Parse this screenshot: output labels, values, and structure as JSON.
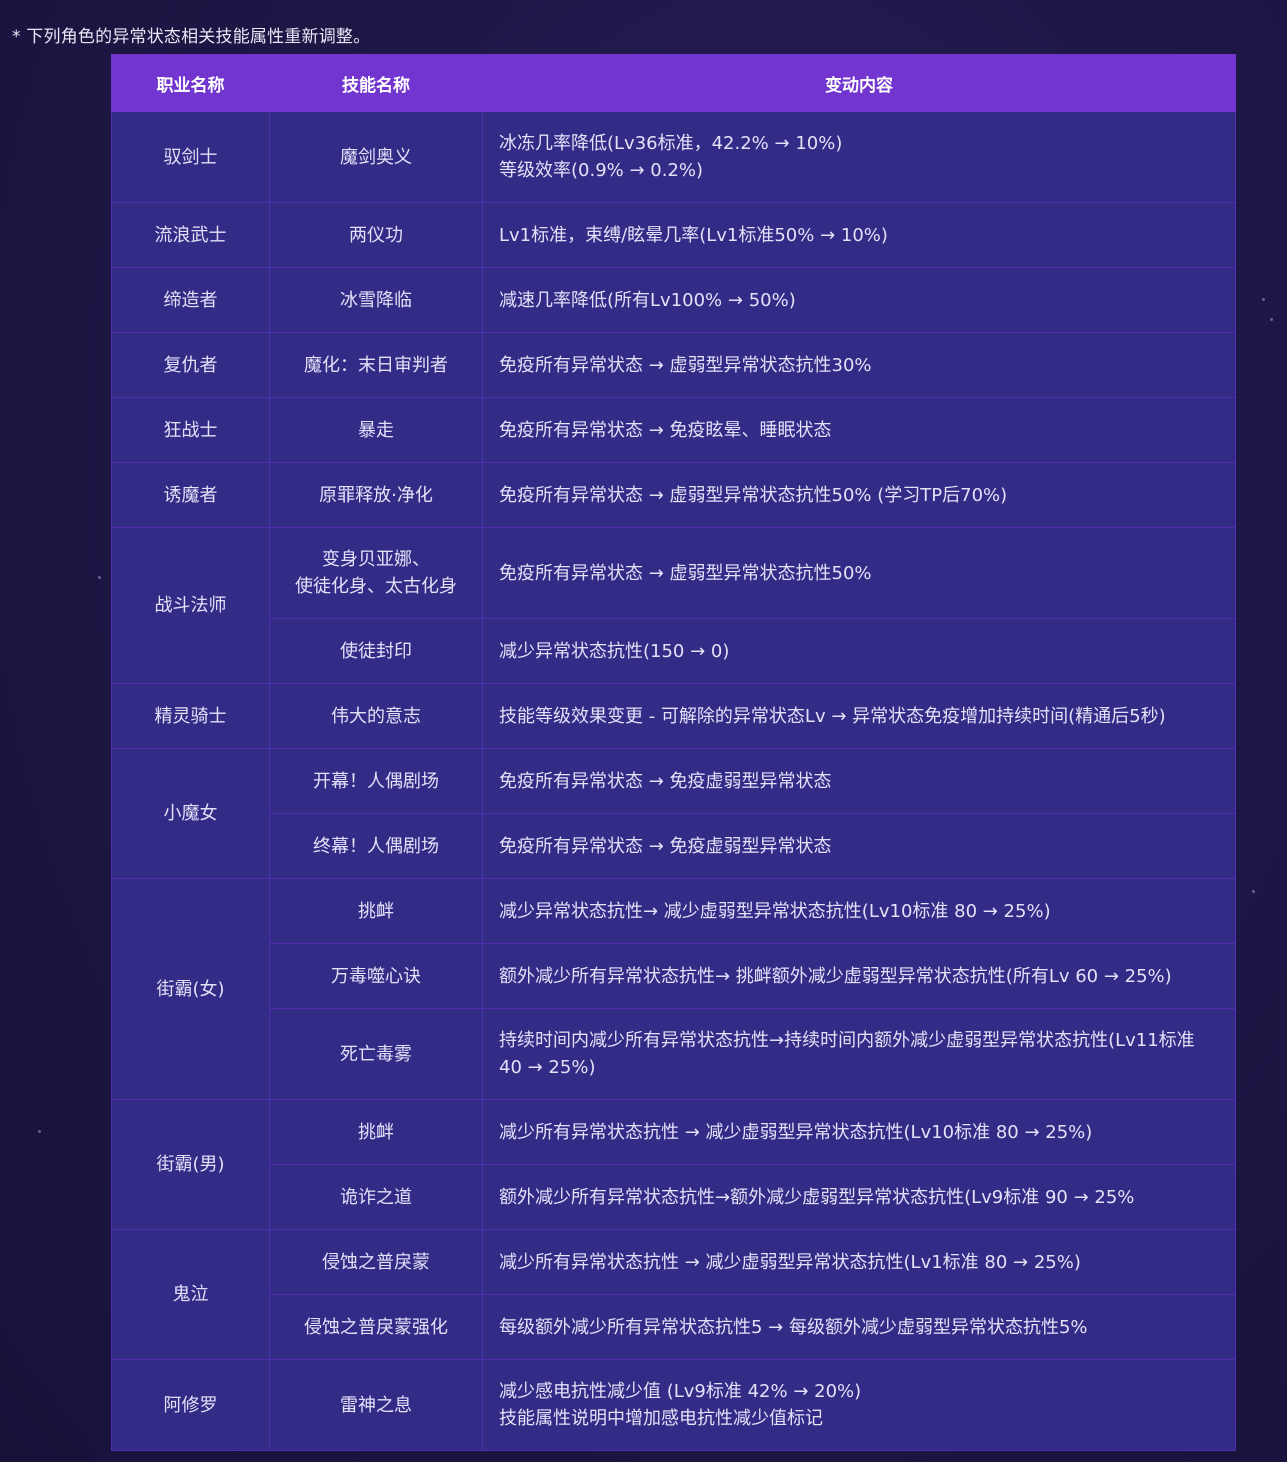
{
  "note": "* 下列角色的异常状态相关技能属性重新调整。",
  "columns": [
    "职业名称",
    "技能名称",
    "变动内容"
  ],
  "rows": [
    {
      "job": "驭剑士",
      "skill": "魔剑奥义",
      "lines": [
        "冰冻几率降低(Lv36标准，42.2% → 10%)",
        "等级效率(0.9% → 0.2%)"
      ]
    },
    {
      "job": "流浪武士",
      "skill": "两仪功",
      "lines": [
        "Lv1标准，束缚/眩晕几率(Lv1标准50% → 10%)"
      ]
    },
    {
      "job": "缔造者",
      "skill": "冰雪降临",
      "lines": [
        "减速几率降低(所有Lv100% → 50%)"
      ]
    },
    {
      "job": "复仇者",
      "skill": "魔化：末日审判者",
      "lines": [
        "免疫所有异常状态 → 虚弱型异常状态抗性30%"
      ]
    },
    {
      "job": "狂战士",
      "skill": "暴走",
      "lines": [
        "免疫所有异常状态 → 免疫眩晕、睡眠状态"
      ]
    },
    {
      "job": "诱魔者",
      "skill": "原罪释放·净化",
      "lines": [
        "免疫所有异常状态 → 虚弱型异常状态抗性50% (学习TP后70%)"
      ]
    },
    {
      "job": "战斗法师",
      "skill_lines": [
        "变身贝亚娜、",
        "使徒化身、太古化身"
      ],
      "lines": [
        "免疫所有异常状态 → 虚弱型异常状态抗性50%"
      ]
    },
    {
      "skill": "使徒封印",
      "lines": [
        "减少异常状态抗性(150 → 0)"
      ]
    },
    {
      "job": "精灵骑士",
      "skill": "伟大的意志",
      "lines": [
        "技能等级效果变更 - 可解除的异常状态Lv → 异常状态免疫增加持续时间(精通后5秒)"
      ]
    },
    {
      "job": "小魔女",
      "skill": "开幕！人偶剧场",
      "lines": [
        "免疫所有异常状态 → 免疫虚弱型异常状态"
      ]
    },
    {
      "skill": "终幕！人偶剧场",
      "lines": [
        "免疫所有异常状态 → 免疫虚弱型异常状态"
      ]
    },
    {
      "job": "街霸(女)",
      "skill": "挑衅",
      "lines": [
        "减少异常状态抗性→ 减少虚弱型异常状态抗性(Lv10标准 80 → 25%)"
      ]
    },
    {
      "skill": "万毒噬心诀",
      "lines": [
        "额外减少所有异常状态抗性→ 挑衅额外减少虚弱型异常状态抗性(所有Lv 60 → 25%)"
      ]
    },
    {
      "skill": "死亡毒雾",
      "lines": [
        "持续时间内减少所有异常状态抗性→持续时间内额外减少虚弱型异常状态抗性(Lv11标准",
        "40 → 25%)"
      ]
    },
    {
      "job": "街霸(男)",
      "skill": "挑衅",
      "lines": [
        "减少所有异常状态抗性 → 减少虚弱型异常状态抗性(Lv10标准 80 → 25%)"
      ]
    },
    {
      "skill": "诡诈之道",
      "lines": [
        "额外减少所有异常状态抗性→额外减少虚弱型异常状态抗性(Lv9标准 90 → 25%"
      ]
    },
    {
      "job": "鬼泣",
      "skill": "侵蚀之普戾蒙",
      "lines": [
        "减少所有异常状态抗性 → 减少虚弱型异常状态抗性(Lv1标准 80 → 25%)"
      ]
    },
    {
      "skill": "侵蚀之普戾蒙强化",
      "lines": [
        "每级额外减少所有异常状态抗性5 → 每级额外减少虚弱型异常状态抗性5%"
      ]
    },
    {
      "job": "阿修罗",
      "skill": "雷神之息",
      "lines": [
        "减少感电抗性减少值 (Lv9标准 42% → 20%)",
        "技能属性说明中增加感电抗性减少值标记"
      ]
    }
  ]
}
